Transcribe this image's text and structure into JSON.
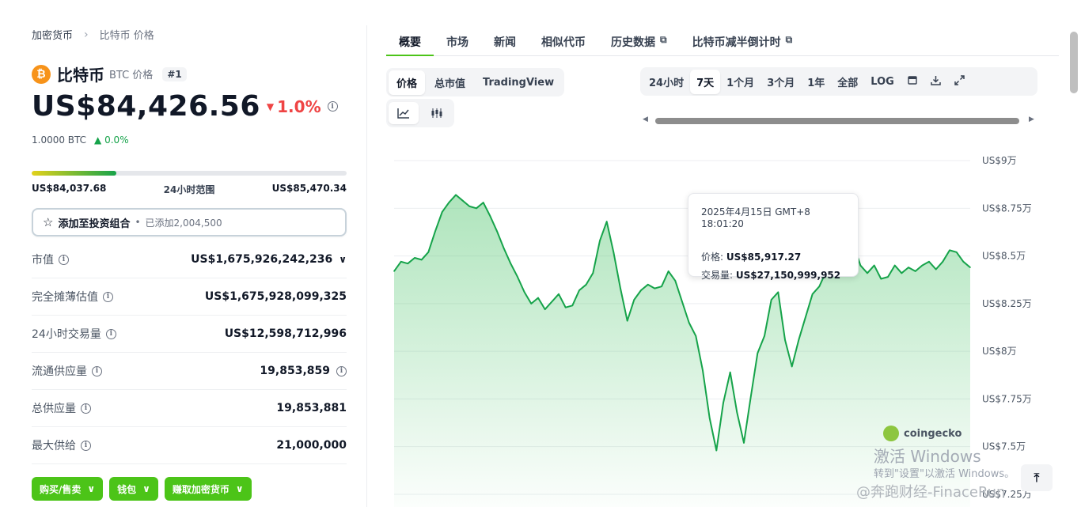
{
  "breadcrumb": {
    "root": "加密货币",
    "separator": "›",
    "current": "比特币 价格"
  },
  "coin": {
    "logo_glyph": "₿",
    "name": "比特币",
    "ticker_label": "BTC 价格",
    "rank": "#1",
    "price": "US$84,426.56",
    "change": "1.0%",
    "btc_value": "1.0000 BTC",
    "btc_change": "0.0%"
  },
  "range24h": {
    "low": "US$84,037.68",
    "label": "24小时范围",
    "high": "US$85,470.34",
    "fill_fraction": 0.27
  },
  "portfolio": {
    "label": "添加至投资组合",
    "bullet": "•",
    "added": "已添加2,004,500"
  },
  "stats": [
    {
      "key": "市值",
      "value": "US$1,675,926,242,236",
      "chevron": "∨"
    },
    {
      "key": "完全摊薄估值",
      "value": "US$1,675,928,099,325"
    },
    {
      "key": "24小时交易量",
      "value": "US$12,598,712,996"
    },
    {
      "key": "流通供应量",
      "value": "19,853,859"
    },
    {
      "key": "总供应量",
      "value": "19,853,881"
    },
    {
      "key": "最大供给",
      "value": "21,000,000"
    }
  ],
  "actions": {
    "buy_sell": "购买/售卖",
    "wallet": "钱包",
    "earn": "赚取加密货币"
  },
  "tabs": [
    "概要",
    "市场",
    "新闻",
    "相似代币",
    "历史数据",
    "比特币减半倒计时"
  ],
  "chart_type_tabs": [
    "价格",
    "总市值",
    "TradingView"
  ],
  "range_tabs": [
    "24小时",
    "7天",
    "1个月",
    "3个月",
    "1年",
    "全部",
    "LOG"
  ],
  "icons": {
    "line_chart": "line-chart-icon",
    "candles": "candlestick-icon",
    "calendar": "calendar-icon",
    "download": "download-icon",
    "expand": "expand-icon",
    "external": "external-link-icon"
  },
  "tooltip": {
    "datetime": "2025年4月15日 GMT+8 18:01:20",
    "price_label": "价格:",
    "price": "US$85,917.27",
    "volume_label": "交易量:",
    "volume": "US$27,150,999,952"
  },
  "brand": "coingecko",
  "watermark": {
    "line1": "激活 Windows",
    "line2": "转到\"设置\"以激活 Windows。",
    "line3": "@奔跑财经-FinaceRun"
  },
  "colors": {
    "accent": "#4cc418",
    "line": "#16a34a",
    "down": "#ef4444",
    "btc": "#f7931a"
  },
  "chart_data": {
    "type": "area",
    "ylabel": "",
    "y_ticks": [
      "US$9万",
      "US$8.75万",
      "US$8.5万",
      "US$8.25万",
      "US$8万",
      "US$7.75万",
      "US$7.5万",
      "US$7.25万"
    ],
    "y_tick_values": [
      90000,
      87500,
      85000,
      82500,
      80000,
      77500,
      75000,
      72500
    ],
    "ylim": [
      72000,
      90500
    ],
    "grid": true,
    "series": [
      {
        "values": [
          84200,
          84700,
          84600,
          84900,
          84800,
          85200,
          86300,
          87300,
          87800,
          88200,
          87900,
          87600,
          87500,
          87800,
          87100,
          86300,
          85400,
          84600,
          83900,
          83100,
          82500,
          82800,
          82200,
          82600,
          83000,
          82300,
          82400,
          83200,
          83500,
          84100,
          85800,
          86800,
          85200,
          83300,
          81600,
          82700,
          83200,
          83500,
          83300,
          83400,
          84200,
          83700,
          82600,
          81500,
          80800,
          79000,
          76500,
          74800,
          77300,
          78900,
          76800,
          75200,
          77600,
          79900,
          80800,
          82700,
          83100,
          80600,
          79200,
          80600,
          81800,
          83000,
          83400,
          84200,
          84900,
          84800,
          85300,
          85600,
          84500,
          84100,
          84500,
          83800,
          83900,
          84500,
          84100,
          84400,
          84200,
          84500,
          84700,
          84300,
          84700,
          85300,
          85200,
          84700,
          84400
        ]
      }
    ]
  }
}
